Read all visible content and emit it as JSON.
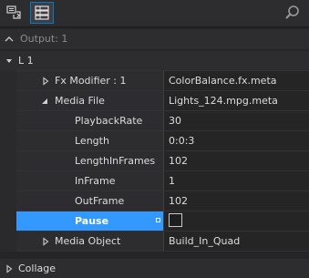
{
  "header": {
    "title": "Output: 1"
  },
  "group": {
    "label": "L 1"
  },
  "properties": [
    {
      "label": "Fx Modifier : 1",
      "value": "ColorBalance.fx.meta"
    },
    {
      "label": "Media File",
      "value": "Lights_124.mpg.meta"
    },
    {
      "label": "PlaybackRate",
      "value": "30"
    },
    {
      "label": "Length",
      "value": "0:0:3"
    },
    {
      "label": "LengthInFrames",
      "value": "102"
    },
    {
      "label": "InFrame",
      "value": "1"
    },
    {
      "label": "OutFrame",
      "value": "102"
    },
    {
      "label": "Pause",
      "value": ""
    },
    {
      "label": "Media Object",
      "value": "Build_In_Quad"
    }
  ],
  "collage": {
    "label": "Collage"
  },
  "colors": {
    "selection": "#3399ff",
    "accent_border": "#007acc",
    "background": "#252526"
  },
  "icons": {
    "toolbar_1": "categorized-view-icon",
    "toolbar_2": "property-list-icon",
    "search": "search-icon"
  }
}
